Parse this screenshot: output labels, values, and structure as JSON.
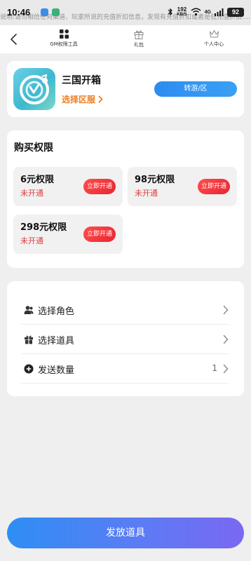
{
  "status_bar": {
    "time": "10:46",
    "net_speed_value": "192",
    "net_speed_unit": "KB/S",
    "network_type": "4G",
    "battery_level": "92",
    "notice_text": "说明:请勿相信任何渠道、玩家所说的充值折扣信息，发现有充值折扣或者是低充值折扣……"
  },
  "header": {
    "tabs": [
      {
        "label": "GM权限工具",
        "icon": "grid-icon"
      },
      {
        "label": "礼包",
        "icon": "gift-icon"
      },
      {
        "label": "个人中心",
        "icon": "crown-icon"
      }
    ]
  },
  "game_card": {
    "title": "三国开箱",
    "select_server_label": "选择区服",
    "switch_button_label": "转游/区",
    "logo_icon": "game-logo-icon"
  },
  "purchase": {
    "title": "购买权限",
    "items": [
      {
        "name": "6元权限",
        "status": "未开通",
        "button": "立即开通"
      },
      {
        "name": "98元权限",
        "status": "未开通",
        "button": "立即开通"
      },
      {
        "name": "298元权限",
        "status": "未开通",
        "button": "立即开通"
      }
    ]
  },
  "settings": {
    "rows": [
      {
        "label": "选择角色",
        "icon": "user-icon",
        "value": ""
      },
      {
        "label": "选择道具",
        "icon": "gift-icon",
        "value": ""
      },
      {
        "label": "发送数量",
        "icon": "plus-circle-icon",
        "value": "1"
      }
    ]
  },
  "footer": {
    "release_button_label": "发放道具"
  },
  "colors": {
    "accent_blue": "#2d8cf0",
    "status_red": "#e23b3b",
    "server_orange": "#ee7d1f",
    "button_red": "#e8262f"
  }
}
